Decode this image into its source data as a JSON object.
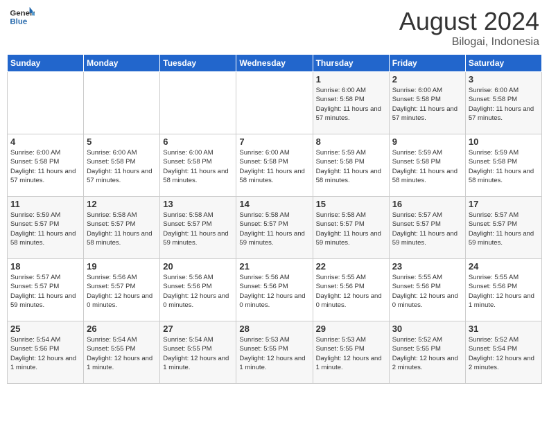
{
  "header": {
    "logo_general": "General",
    "logo_blue": "Blue",
    "title": "August 2024",
    "location": "Bilogai, Indonesia"
  },
  "weekdays": [
    "Sunday",
    "Monday",
    "Tuesday",
    "Wednesday",
    "Thursday",
    "Friday",
    "Saturday"
  ],
  "weeks": [
    [
      {
        "day": "",
        "info": ""
      },
      {
        "day": "",
        "info": ""
      },
      {
        "day": "",
        "info": ""
      },
      {
        "day": "",
        "info": ""
      },
      {
        "day": "1",
        "info": "Sunrise: 6:00 AM\nSunset: 5:58 PM\nDaylight: 11 hours and 57 minutes."
      },
      {
        "day": "2",
        "info": "Sunrise: 6:00 AM\nSunset: 5:58 PM\nDaylight: 11 hours and 57 minutes."
      },
      {
        "day": "3",
        "info": "Sunrise: 6:00 AM\nSunset: 5:58 PM\nDaylight: 11 hours and 57 minutes."
      }
    ],
    [
      {
        "day": "4",
        "info": "Sunrise: 6:00 AM\nSunset: 5:58 PM\nDaylight: 11 hours and 57 minutes."
      },
      {
        "day": "5",
        "info": "Sunrise: 6:00 AM\nSunset: 5:58 PM\nDaylight: 11 hours and 57 minutes."
      },
      {
        "day": "6",
        "info": "Sunrise: 6:00 AM\nSunset: 5:58 PM\nDaylight: 11 hours and 58 minutes."
      },
      {
        "day": "7",
        "info": "Sunrise: 6:00 AM\nSunset: 5:58 PM\nDaylight: 11 hours and 58 minutes."
      },
      {
        "day": "8",
        "info": "Sunrise: 5:59 AM\nSunset: 5:58 PM\nDaylight: 11 hours and 58 minutes."
      },
      {
        "day": "9",
        "info": "Sunrise: 5:59 AM\nSunset: 5:58 PM\nDaylight: 11 hours and 58 minutes."
      },
      {
        "day": "10",
        "info": "Sunrise: 5:59 AM\nSunset: 5:58 PM\nDaylight: 11 hours and 58 minutes."
      }
    ],
    [
      {
        "day": "11",
        "info": "Sunrise: 5:59 AM\nSunset: 5:57 PM\nDaylight: 11 hours and 58 minutes."
      },
      {
        "day": "12",
        "info": "Sunrise: 5:58 AM\nSunset: 5:57 PM\nDaylight: 11 hours and 58 minutes."
      },
      {
        "day": "13",
        "info": "Sunrise: 5:58 AM\nSunset: 5:57 PM\nDaylight: 11 hours and 59 minutes."
      },
      {
        "day": "14",
        "info": "Sunrise: 5:58 AM\nSunset: 5:57 PM\nDaylight: 11 hours and 59 minutes."
      },
      {
        "day": "15",
        "info": "Sunrise: 5:58 AM\nSunset: 5:57 PM\nDaylight: 11 hours and 59 minutes."
      },
      {
        "day": "16",
        "info": "Sunrise: 5:57 AM\nSunset: 5:57 PM\nDaylight: 11 hours and 59 minutes."
      },
      {
        "day": "17",
        "info": "Sunrise: 5:57 AM\nSunset: 5:57 PM\nDaylight: 11 hours and 59 minutes."
      }
    ],
    [
      {
        "day": "18",
        "info": "Sunrise: 5:57 AM\nSunset: 5:57 PM\nDaylight: 11 hours and 59 minutes."
      },
      {
        "day": "19",
        "info": "Sunrise: 5:56 AM\nSunset: 5:57 PM\nDaylight: 12 hours and 0 minutes."
      },
      {
        "day": "20",
        "info": "Sunrise: 5:56 AM\nSunset: 5:56 PM\nDaylight: 12 hours and 0 minutes."
      },
      {
        "day": "21",
        "info": "Sunrise: 5:56 AM\nSunset: 5:56 PM\nDaylight: 12 hours and 0 minutes."
      },
      {
        "day": "22",
        "info": "Sunrise: 5:55 AM\nSunset: 5:56 PM\nDaylight: 12 hours and 0 minutes."
      },
      {
        "day": "23",
        "info": "Sunrise: 5:55 AM\nSunset: 5:56 PM\nDaylight: 12 hours and 0 minutes."
      },
      {
        "day": "24",
        "info": "Sunrise: 5:55 AM\nSunset: 5:56 PM\nDaylight: 12 hours and 1 minute."
      }
    ],
    [
      {
        "day": "25",
        "info": "Sunrise: 5:54 AM\nSunset: 5:56 PM\nDaylight: 12 hours and 1 minute."
      },
      {
        "day": "26",
        "info": "Sunrise: 5:54 AM\nSunset: 5:55 PM\nDaylight: 12 hours and 1 minute."
      },
      {
        "day": "27",
        "info": "Sunrise: 5:54 AM\nSunset: 5:55 PM\nDaylight: 12 hours and 1 minute."
      },
      {
        "day": "28",
        "info": "Sunrise: 5:53 AM\nSunset: 5:55 PM\nDaylight: 12 hours and 1 minute."
      },
      {
        "day": "29",
        "info": "Sunrise: 5:53 AM\nSunset: 5:55 PM\nDaylight: 12 hours and 1 minute."
      },
      {
        "day": "30",
        "info": "Sunrise: 5:52 AM\nSunset: 5:55 PM\nDaylight: 12 hours and 2 minutes."
      },
      {
        "day": "31",
        "info": "Sunrise: 5:52 AM\nSunset: 5:54 PM\nDaylight: 12 hours and 2 minutes."
      }
    ]
  ]
}
